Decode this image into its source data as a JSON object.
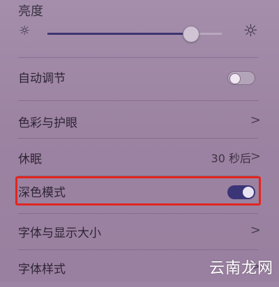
{
  "section_title": "亮度",
  "brightness": {
    "level": 0.82,
    "min_icon": "sun-small-icon",
    "max_icon": "sun-large-icon"
  },
  "settings": [
    {
      "id": "auto-adjust",
      "label": "自动调节",
      "control": "toggle",
      "on": false
    },
    {
      "id": "color-eye",
      "label": "色彩与护眼",
      "control": "chevron"
    },
    {
      "id": "sleep",
      "label": "休眠",
      "value": "30 秒后",
      "control": "chevron"
    },
    {
      "id": "dark-mode",
      "label": "深色模式",
      "control": "toggle",
      "on": true
    },
    {
      "id": "font-size",
      "label": "字体与显示大小",
      "control": "chevron"
    },
    {
      "id": "font-style",
      "label": "字体样式",
      "control": "chevron"
    }
  ],
  "chevron_glyph": ">",
  "watermark": "云南龙网",
  "colors": {
    "toggle_on": "#3a3576",
    "highlight": "#e2251f"
  }
}
